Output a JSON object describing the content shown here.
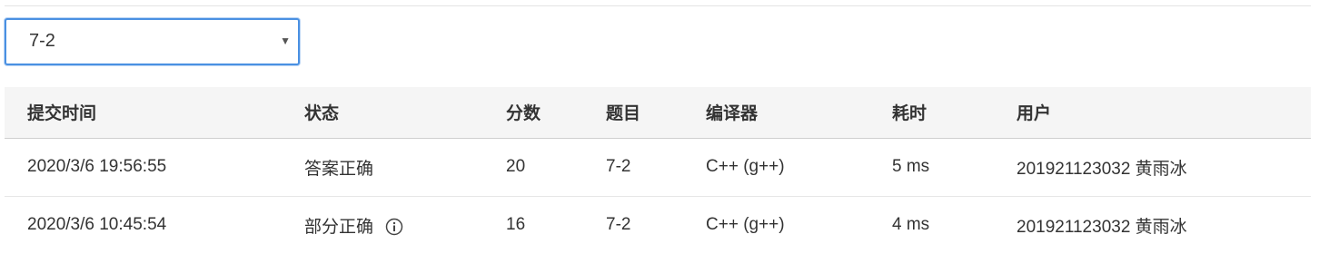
{
  "problem_select": {
    "value": "7-2"
  },
  "table": {
    "headers": [
      "提交时间",
      "状态",
      "分数",
      "题目",
      "编译器",
      "耗时",
      "用户"
    ],
    "rows": [
      {
        "time": "2020/3/6 19:56:55",
        "status": "答案正确",
        "score": "20",
        "problem": "7-2",
        "compiler": "C++ (g++)",
        "duration": "5 ms",
        "user": "201921123032 黄雨冰"
      },
      {
        "time": "2020/3/6 10:45:54",
        "status": "部分正确",
        "score": "16",
        "problem": "7-2",
        "compiler": "C++ (g++)",
        "duration": "4 ms",
        "user": "201921123032 黄雨冰"
      }
    ]
  },
  "colors": {
    "status_accepted": "#d9534f",
    "status_partial": "#2f9b2f",
    "link": "#1d4f8a",
    "select_focus": "#4a90e2"
  },
  "icons": {
    "partial_info": "info-circle-icon",
    "select_caret": "caret-down-icon"
  }
}
